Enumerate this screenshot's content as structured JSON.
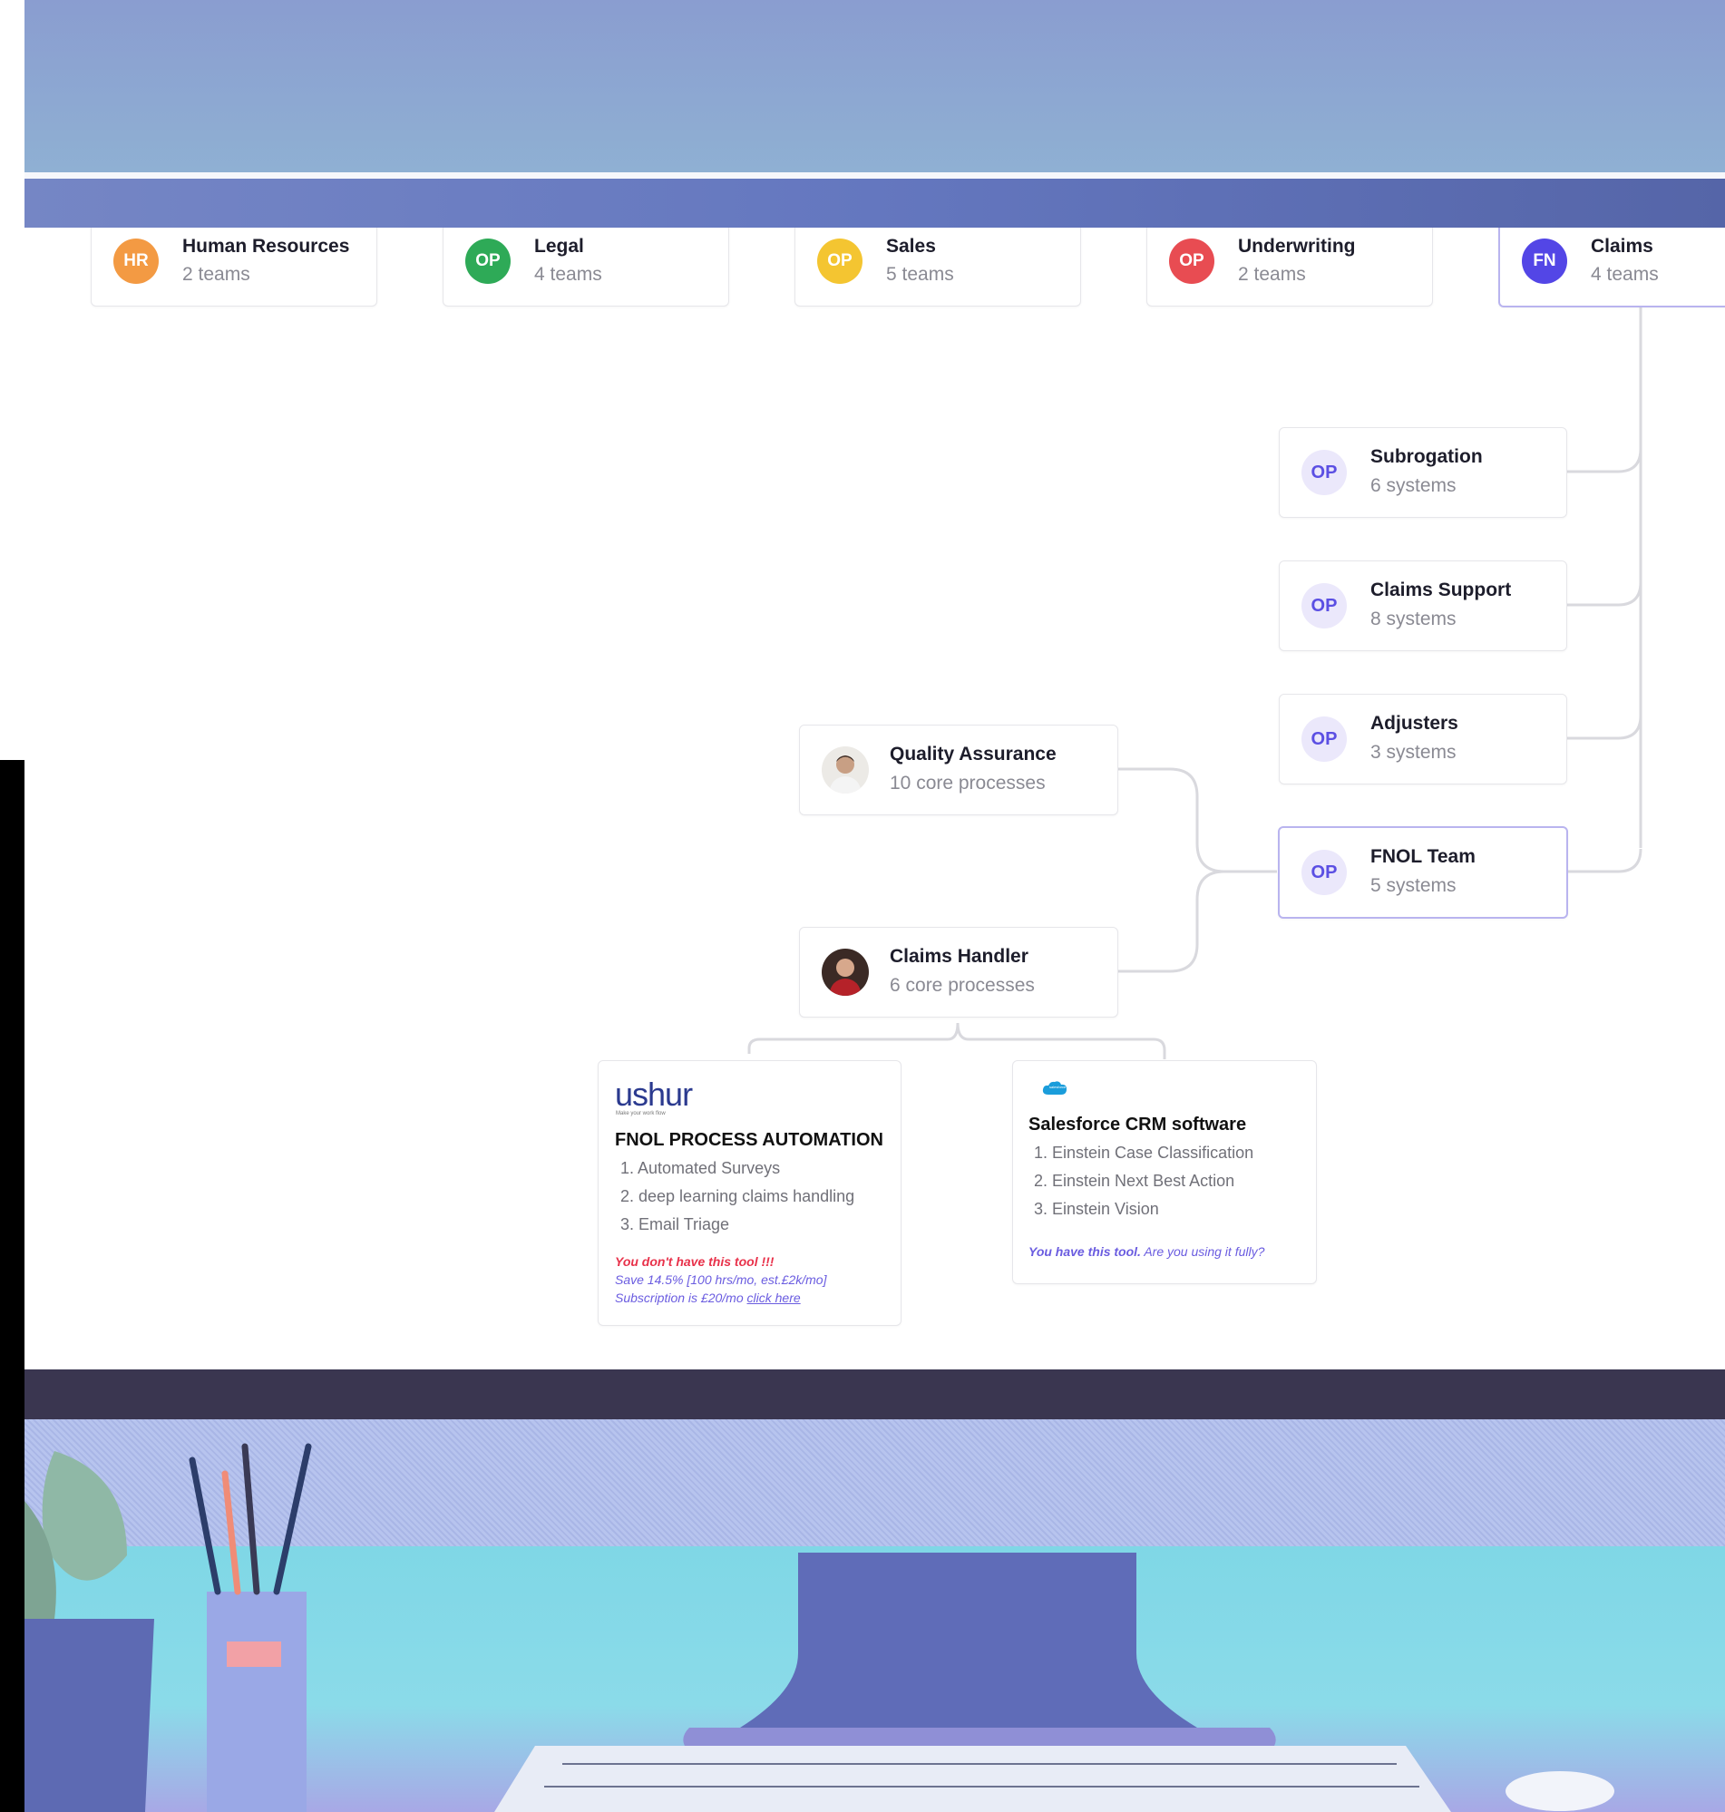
{
  "departments": [
    {
      "badge": "HR",
      "name": "Human Resources",
      "count": "2 teams",
      "color": "#f39a43"
    },
    {
      "badge": "OP",
      "name": "Legal",
      "count": "4 teams",
      "color": "#2eaa57"
    },
    {
      "badge": "OP",
      "name": "Sales",
      "count": "5 teams",
      "color": "#f4c531"
    },
    {
      "badge": "OP",
      "name": "Underwriting",
      "count": "2 teams",
      "color": "#e84c52"
    },
    {
      "badge": "FN",
      "name": "Claims",
      "count": "4 teams",
      "color": "#5346e6"
    }
  ],
  "teams": [
    {
      "badge": "OP",
      "name": "Subrogation",
      "count": "6 systems"
    },
    {
      "badge": "OP",
      "name": "Claims Support",
      "count": "8 systems"
    },
    {
      "badge": "OP",
      "name": "Adjusters",
      "count": "3 systems"
    },
    {
      "badge": "OP",
      "name": "FNOL Team",
      "count": "5 systems"
    }
  ],
  "roles": [
    {
      "name": "Quality Assurance",
      "count": "10 core processes"
    },
    {
      "name": "Claims Handler",
      "count": "6 core processes"
    }
  ],
  "tools": [
    {
      "logo": "ushur",
      "logo_tagline": "Make your work flow",
      "title": "FNOL PROCESS AUTOMATION",
      "items": [
        "1. Automated Surveys",
        "2. deep learning claims handling",
        "3. Email Triage"
      ],
      "warning": "You don't have this tool !!!",
      "save_note": "Save 14.5% [100 hrs/mo, est.£2k/mo]",
      "subscription_note": "Subscription is £20/mo",
      "link_label": "click here"
    },
    {
      "logo": "salesforce",
      "logo_text": "salesforce",
      "title": "Salesforce CRM software",
      "items": [
        "1. Einstein Case Classification",
        "2. Einstein Next Best Action",
        "3. Einstein Vision"
      ],
      "have_note": "You have this tool.",
      "usage_note": "Are you using it fully?"
    }
  ],
  "colors": {
    "accent": "#5b4fe3",
    "warning": "#e8314a",
    "link": "#6a5ce0",
    "connector": "#d9d9de"
  },
  "icons": {
    "qa_avatar": "person-avatar-icon",
    "handler_avatar": "person-avatar-icon",
    "salesforce": "salesforce-cloud-icon"
  }
}
